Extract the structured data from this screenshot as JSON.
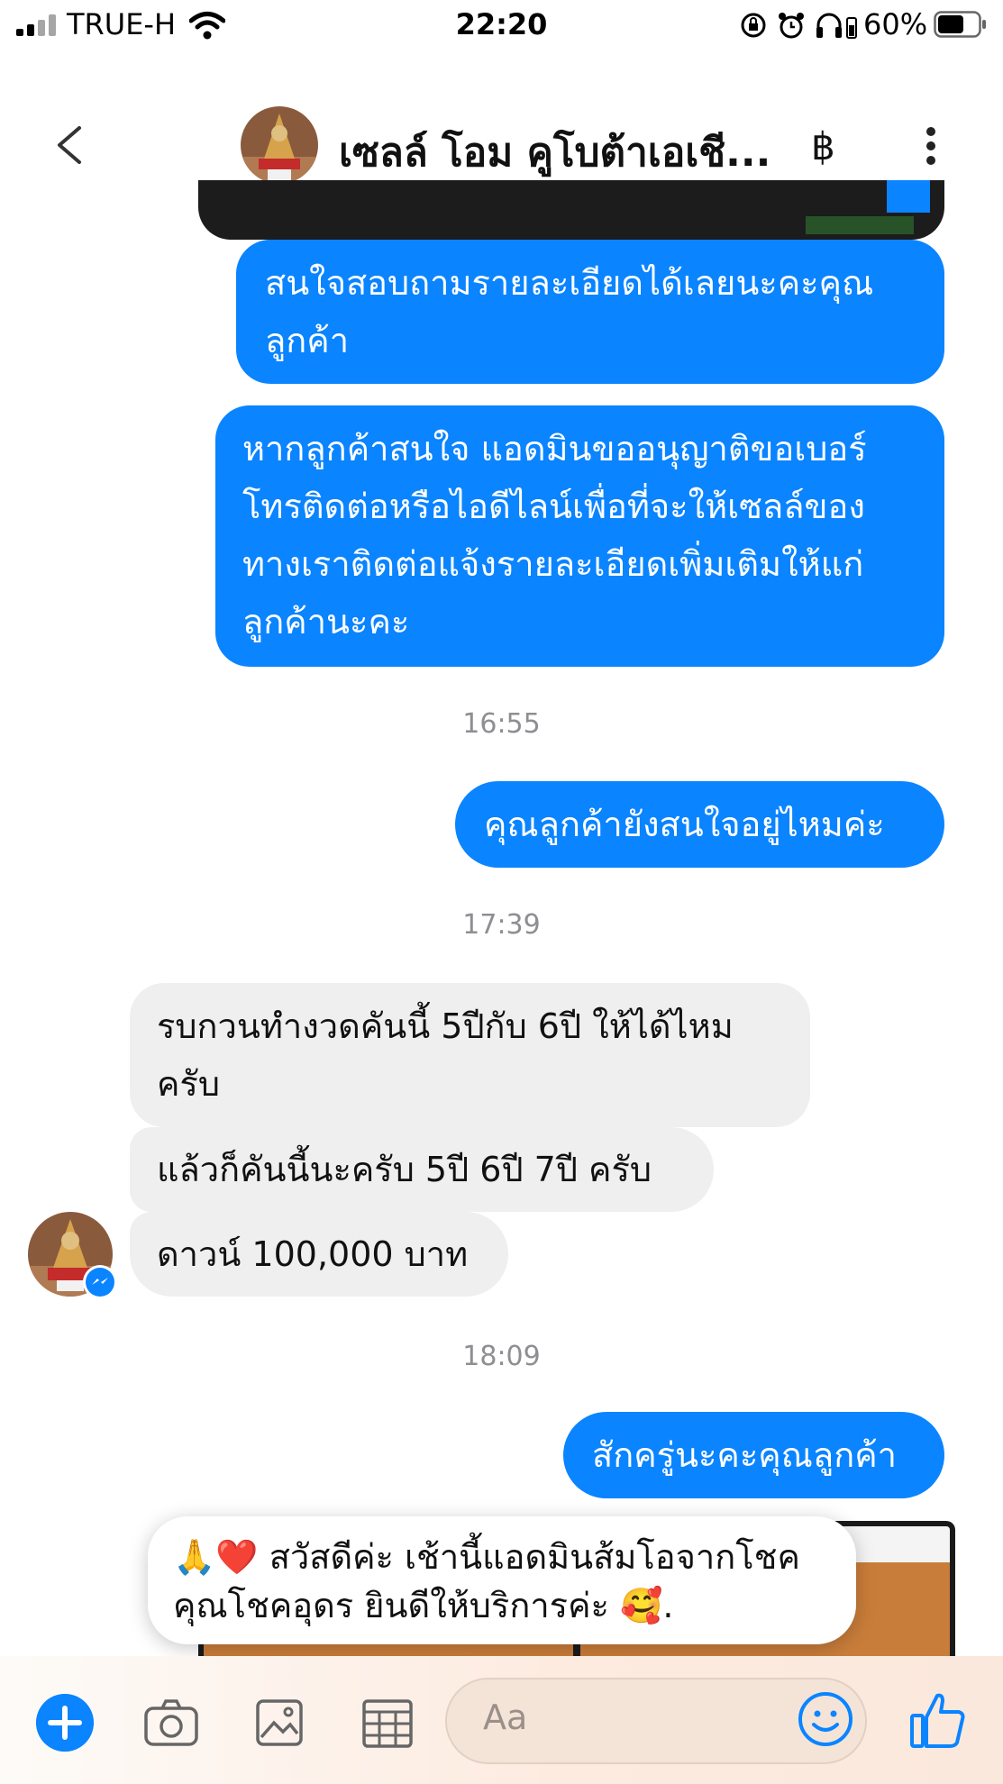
{
  "status_bar": {
    "carrier": "TRUE-H",
    "time": "22:20",
    "battery": "60%"
  },
  "header": {
    "title": "เซลล์ โอม คูโบต้าเอเชี...",
    "currency_symbol": "฿"
  },
  "messages": [
    {
      "dir": "out",
      "lines": [
        "สนใจสอบถามรายละเอียดได้เลยนะคะคุณ",
        "ลูกค้า"
      ]
    },
    {
      "dir": "out",
      "lines": [
        "หากลูกค้าสนใจ แอดมินขออนุญาติขอเบอร์",
        "โทรติดต่อหรือไอดีไลน์เพื่อที่จะให้เซลล์ของ",
        "ทางเราติดต่อแจ้งรายละเอียดเพิ่มเติมให้แก่",
        "ลูกค้านะคะ"
      ]
    },
    {
      "dir": "out",
      "lines": [
        "คุณลูกค้ายังสนใจอยู่ไหมค่ะ"
      ]
    },
    {
      "dir": "in",
      "lines": [
        "รบกวนทำงวดคันนี้ 5ปีกับ 6ปี ให้ได้ไหม",
        "ครับ"
      ]
    },
    {
      "dir": "in",
      "lines": [
        "แล้วก็คันนี้นะครับ 5ปี 6ปี 7ปี ครับ"
      ]
    },
    {
      "dir": "in",
      "lines": [
        "ดาวน์ 100,000 บาท"
      ]
    },
    {
      "dir": "out",
      "lines": [
        "สักครู่นะคะคุณลูกค้า"
      ]
    }
  ],
  "timestamps": [
    "16:55",
    "17:39",
    "18:09"
  ],
  "notification": {
    "emoji_prefix": "🙏❤️",
    "lines": [
      "สวัสดีค่ะ เช้านี้แอดมินส้มโอจากโชค",
      "คุณโชคอุดร ยินดีให้บริการค่ะ"
    ],
    "emoji_suffix": "🥰."
  },
  "composer": {
    "placeholder": "Aa"
  },
  "colors": {
    "accent": "#0a84ff",
    "incoming": "#efefef",
    "timestamp": "#8e8e93"
  },
  "icons": [
    "signal-icon",
    "wifi-icon",
    "rotation-lock-icon",
    "alarm-icon",
    "headphones-icon",
    "battery-icon",
    "back-chevron-icon",
    "more-vertical-icon",
    "plus-icon",
    "camera-icon",
    "gallery-icon",
    "grid-icon",
    "emoji-icon",
    "thumbs-up-icon"
  ]
}
